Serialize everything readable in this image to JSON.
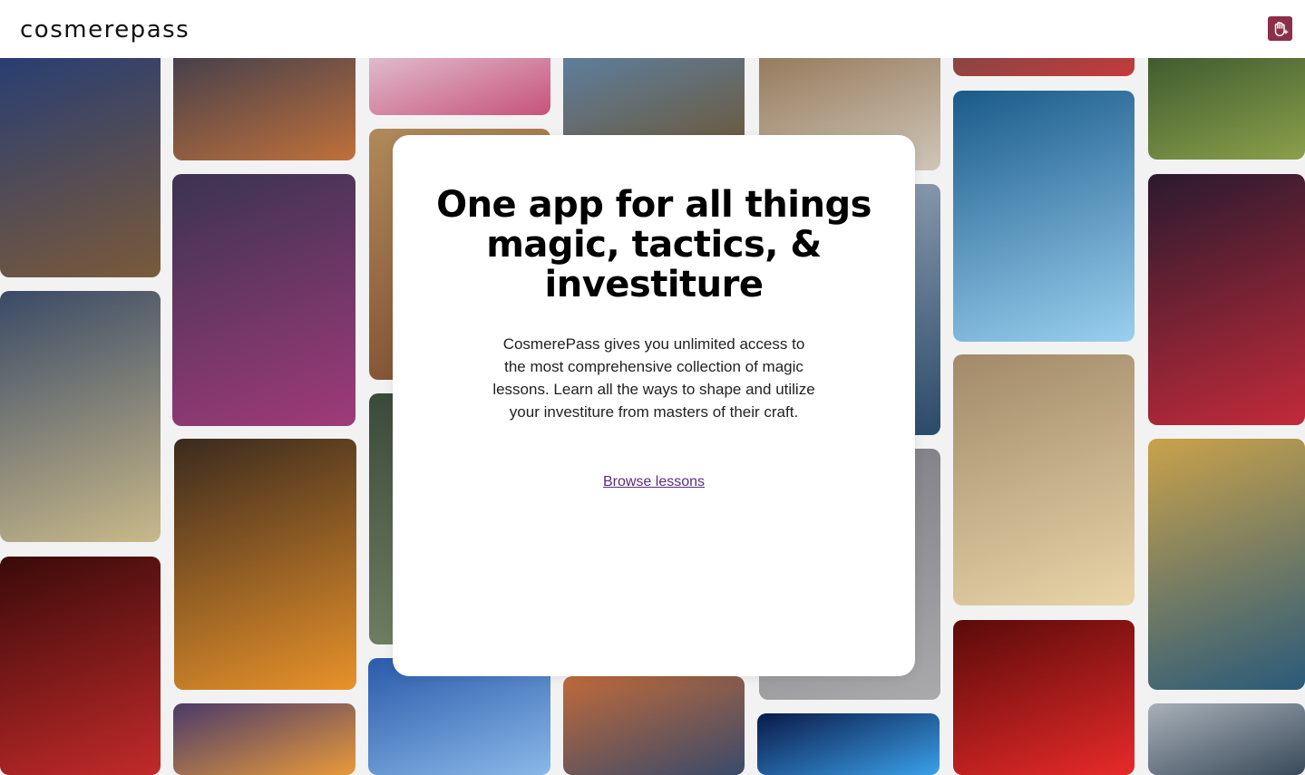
{
  "header": {
    "logo": "cosmerepass",
    "menu_icon": "hand-icon"
  },
  "hero": {
    "title": "One app for all things magic, tactics, & investiture",
    "description": "CosmerePass gives you unlimited access to the most comprehensive collection of magic lessons. Learn all the ways to shape and utilize your investiture from masters of their craft.",
    "cta_label": "Browse lessons"
  },
  "colors": {
    "accent": "#5b2d7c",
    "menu_button": "#8b2f4a",
    "modal_bg": "#ffffff",
    "page_bg": "#f2f2f2"
  },
  "gallery": {
    "cards": [
      {
        "name": "artwork-blue-warrior",
        "colors": [
          "#1e3a7a",
          "#7a5a3a"
        ]
      },
      {
        "name": "artwork-lightning-duel",
        "colors": [
          "#2a3550",
          "#c0703a"
        ]
      },
      {
        "name": "artwork-pink-slash",
        "colors": [
          "#e7dde6",
          "#c7527a"
        ]
      },
      {
        "name": "artwork-armored-knight",
        "colors": [
          "#5b87b5",
          "#6b5a3e"
        ]
      },
      {
        "name": "artwork-bronze-figure",
        "colors": [
          "#8a6b4a",
          "#cfc6b8"
        ]
      },
      {
        "name": "artwork-red-lines",
        "colors": [
          "#6b4a4a",
          "#c73a3a"
        ]
      },
      {
        "name": "artwork-forest-spirit",
        "colors": [
          "#2e4a2a",
          "#8aa04a"
        ]
      },
      {
        "name": "artwork-tarot-soldier",
        "colors": [
          "#3a4a66",
          "#c9b98a"
        ]
      },
      {
        "name": "artwork-purple-dancer",
        "colors": [
          "#3a3450",
          "#a03a7a"
        ]
      },
      {
        "name": "artwork-desert-warrior",
        "colors": [
          "#b08a5a",
          "#7a4a2e"
        ]
      },
      {
        "name": "artwork-storm-mage",
        "colors": [
          "#1a5a8a",
          "#9ad0ef"
        ]
      },
      {
        "name": "artwork-crimson-sorceress",
        "colors": [
          "#2a1a2e",
          "#c22a3a"
        ]
      },
      {
        "name": "artwork-fire-battle",
        "colors": [
          "#3a2a1e",
          "#e8922a"
        ]
      },
      {
        "name": "artwork-green-valley",
        "colors": [
          "#3a4a3a",
          "#7a8a6a"
        ]
      },
      {
        "name": "artwork-ice-mage",
        "colors": [
          "#9aa8b8",
          "#2a4a6a"
        ]
      },
      {
        "name": "artwork-grey-warrior",
        "colors": [
          "#7a7a80",
          "#aaa9ac"
        ]
      },
      {
        "name": "artwork-falling-hero",
        "colors": [
          "#caa24a",
          "#2a5a7a"
        ]
      },
      {
        "name": "artwork-red-knight",
        "colors": [
          "#3a0a0a",
          "#c22a2a"
        ]
      },
      {
        "name": "artwork-golden-glow",
        "colors": [
          "#a08a6a",
          "#e8d5a8"
        ]
      },
      {
        "name": "artwork-blue-face",
        "colors": [
          "#2a5aaa",
          "#8ab8e8"
        ]
      },
      {
        "name": "artwork-sunset-walker",
        "colors": [
          "#c06a3a",
          "#3a4a6a"
        ]
      },
      {
        "name": "artwork-violet-flames",
        "colors": [
          "#4a3a6a",
          "#e89a3a"
        ]
      },
      {
        "name": "artwork-blue-fists",
        "colors": [
          "#0a1a4a",
          "#3aa0e8"
        ]
      },
      {
        "name": "artwork-red-moon",
        "colors": [
          "#5a0a0a",
          "#e82a2a"
        ]
      },
      {
        "name": "artwork-sword-slash",
        "colors": [
          "#a8b0b8",
          "#3a4a5a"
        ]
      }
    ]
  }
}
